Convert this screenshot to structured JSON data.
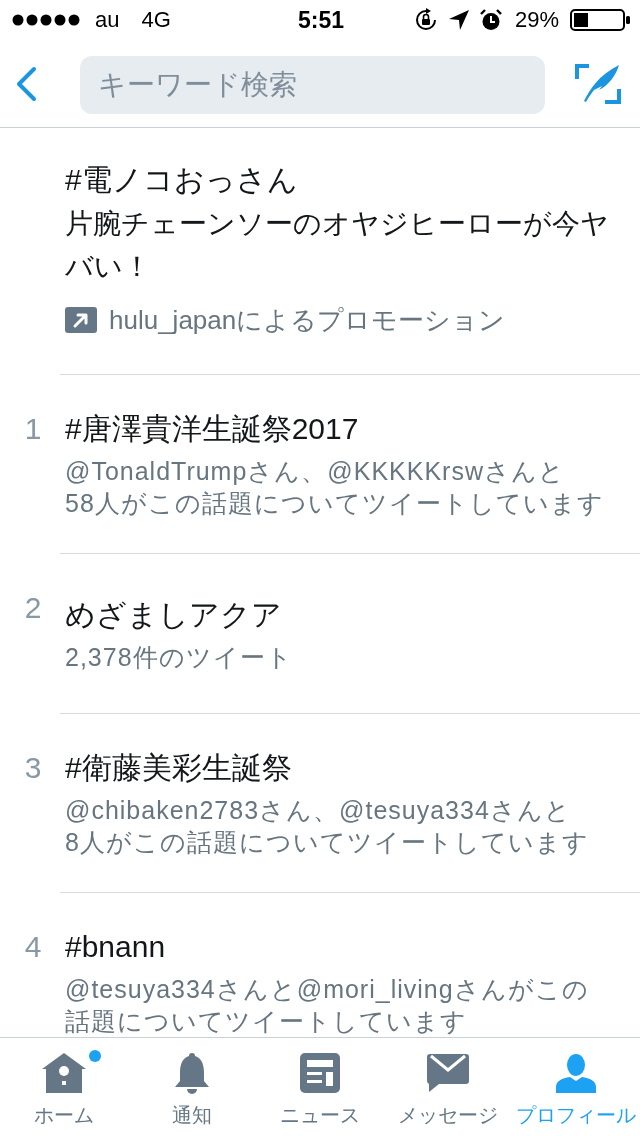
{
  "status_bar": {
    "carrier": "au",
    "network": "4G",
    "time": "5:51",
    "battery": "29%"
  },
  "nav": {
    "search": {
      "placeholder": "キーワード検索"
    }
  },
  "promoted": {
    "title": "#電ノコおっさん",
    "description": "片腕チェーンソーのオヤジヒーローが今ヤバい！",
    "promoted_by": "hulu_japanによるプロモーション"
  },
  "trends": [
    {
      "rank": "1",
      "title": "#唐澤貴洋生誕祭2017",
      "context": "@TonaldTrumpさん、@KKKKKrswさんと\n58人がこの話題についてツイートしています"
    },
    {
      "rank": "2",
      "title": "めざましアクア",
      "context": "2,378件のツイート"
    },
    {
      "rank": "3",
      "title": "#衛藤美彩生誕祭",
      "context": "@chibaken2783さん、@tesuya334さんと\n8人がこの話題についてツイートしています"
    },
    {
      "rank": "4",
      "title": "#bnann",
      "context": "@tesuya334さんと@mori_livingさんがこの話題についてツイートしています"
    }
  ],
  "tab_bar": [
    {
      "label": "ホーム",
      "selected": false,
      "unread": true
    },
    {
      "label": "通知",
      "selected": false,
      "unread": false
    },
    {
      "label": "ニュース",
      "selected": false,
      "unread": false
    },
    {
      "label": "メッセージ",
      "selected": false,
      "unread": false
    },
    {
      "label": "プロフィール",
      "selected": true,
      "unread": false
    }
  ]
}
